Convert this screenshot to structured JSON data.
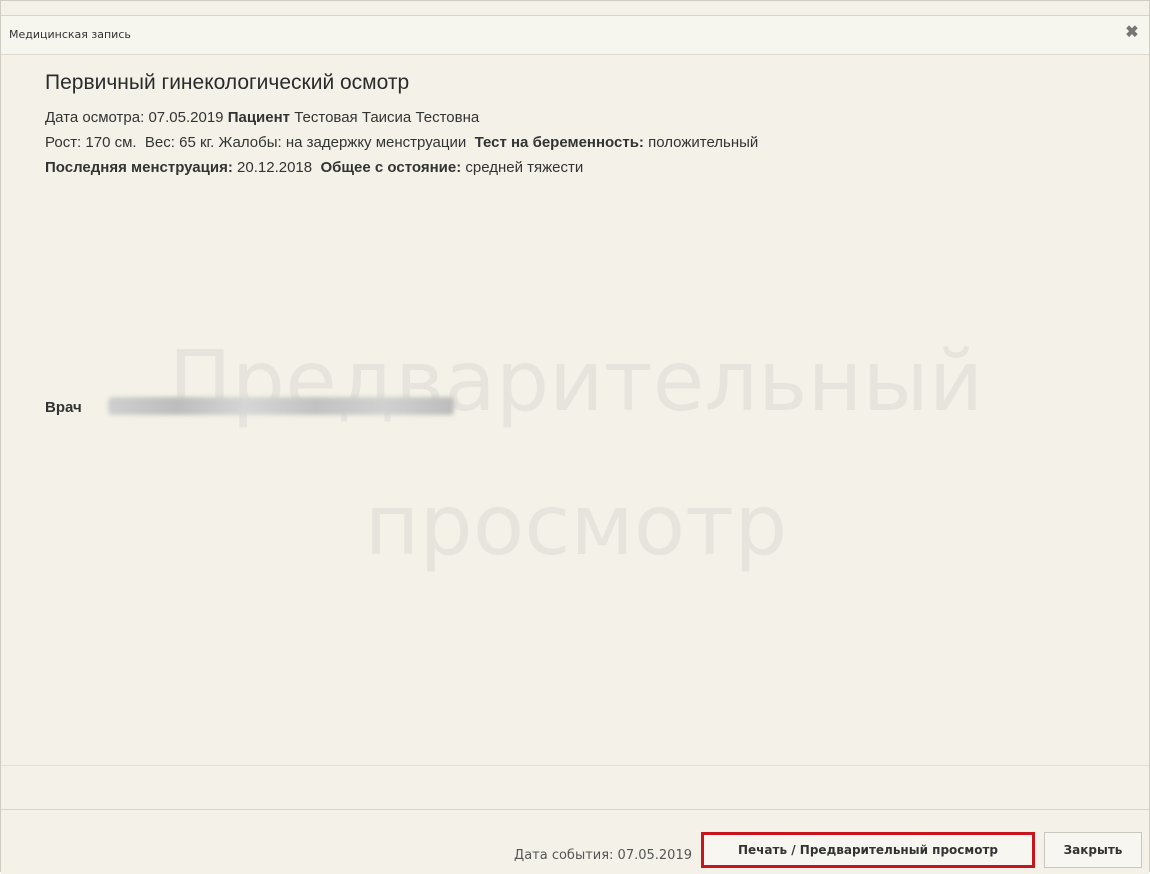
{
  "dialog": {
    "title": "Медицинская запись",
    "close_glyph": "✖"
  },
  "record": {
    "heading": "Первичный гинекологический осмотр",
    "exam_date_label": "Дата осмотра:",
    "exam_date": "07.05.2019",
    "patient_label": "Пациент",
    "patient_name": "Тестовая Таисиа Тестовна",
    "height_text": "Рост: 170 см.",
    "weight_text": "Вес: 65 кг.",
    "complaints_text": "Жалобы: на задержку менструации",
    "pregnancy_label": "Тест на беременность:",
    "pregnancy_value": "положительный",
    "last_period_label": "Последняя менструация:",
    "last_period_value": "20.12.2018",
    "condition_label": "Общее с остояние:",
    "condition_value": "средней тяжести",
    "doctor_label": "Врач"
  },
  "watermark": {
    "line1": "Предварительный",
    "line2": "просмотр"
  },
  "footer": {
    "event_date": "Дата события: 07.05.2019",
    "print_button": "Печать / Предварительный просмотр",
    "close_button": "Закрыть"
  }
}
